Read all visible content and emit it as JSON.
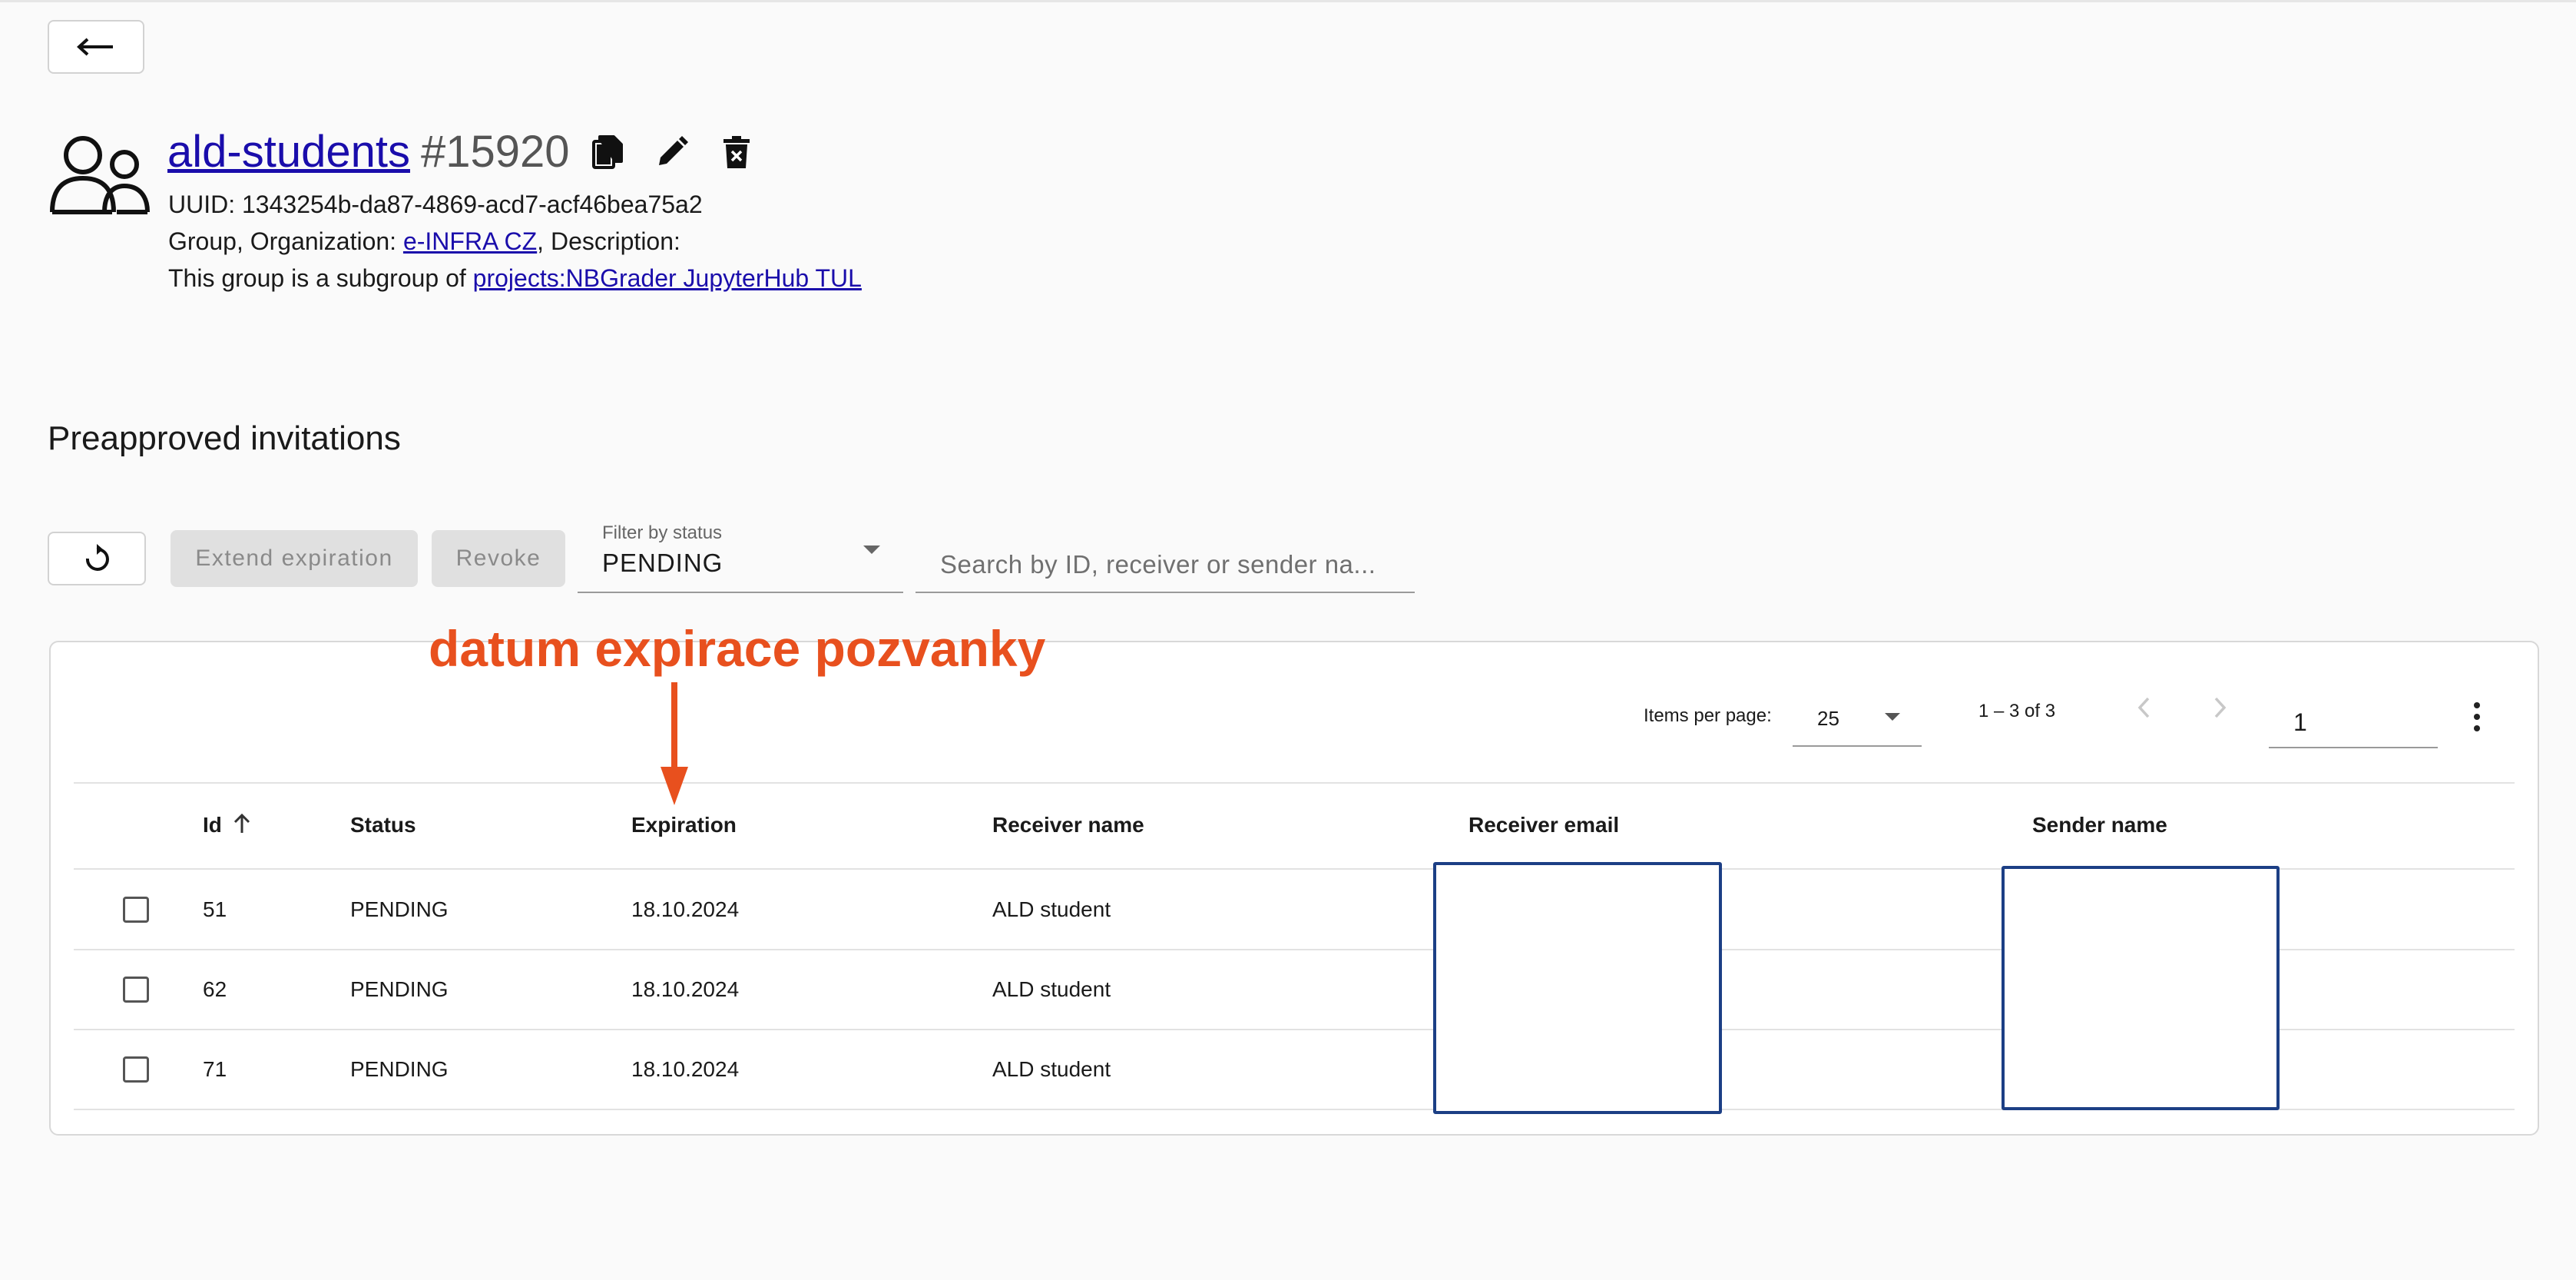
{
  "header": {
    "back_icon": "arrow-left-icon",
    "group_icon": "group-icon",
    "group_name": "ald-students",
    "group_id": "#15920",
    "tools": [
      "copy-icon",
      "edit-icon",
      "delete-icon"
    ],
    "uuid_line": "UUID: 1343254b-da87-4869-acd7-acf46bea75a2",
    "org_prefix": "Group, Organization: ",
    "org_link": "e-INFRA CZ",
    "org_suffix": ", Description:",
    "subgroup_prefix": "This group is a subgroup of ",
    "subgroup_link": "projects:NBGrader JupyterHub TUL"
  },
  "section": {
    "title": "Preapproved invitations"
  },
  "toolbar": {
    "refresh_icon": "refresh-icon",
    "extend_label": "Extend expiration",
    "revoke_label": "Revoke",
    "filter_label": "Filter by status",
    "filter_value": "PENDING",
    "search_placeholder": "Search by ID, receiver or sender na..."
  },
  "paginator": {
    "items_per_page_label": "Items per page:",
    "items_per_page_value": "25",
    "range_label": "1 – 3 of 3",
    "prev_icon": "chevron-left-icon",
    "next_icon": "chevron-right-icon",
    "page_value": "1",
    "more_icon": "more-vert-icon"
  },
  "table": {
    "columns": [
      "Id",
      "Status",
      "Expiration",
      "Receiver name",
      "Receiver email",
      "Sender name"
    ],
    "sort_icon": "arrow-up-icon",
    "rows": [
      {
        "id": "51",
        "status": "PENDING",
        "expiration": "18.10.2024",
        "receiver_name": "ALD student"
      },
      {
        "id": "62",
        "status": "PENDING",
        "expiration": "18.10.2024",
        "receiver_name": "ALD student"
      },
      {
        "id": "71",
        "status": "PENDING",
        "expiration": "18.10.2024",
        "receiver_name": "ALD student"
      }
    ]
  },
  "annotation": {
    "text": "datum expirace pozvanky",
    "color": "#e8501e"
  },
  "redaction_color": "#1c3f85"
}
